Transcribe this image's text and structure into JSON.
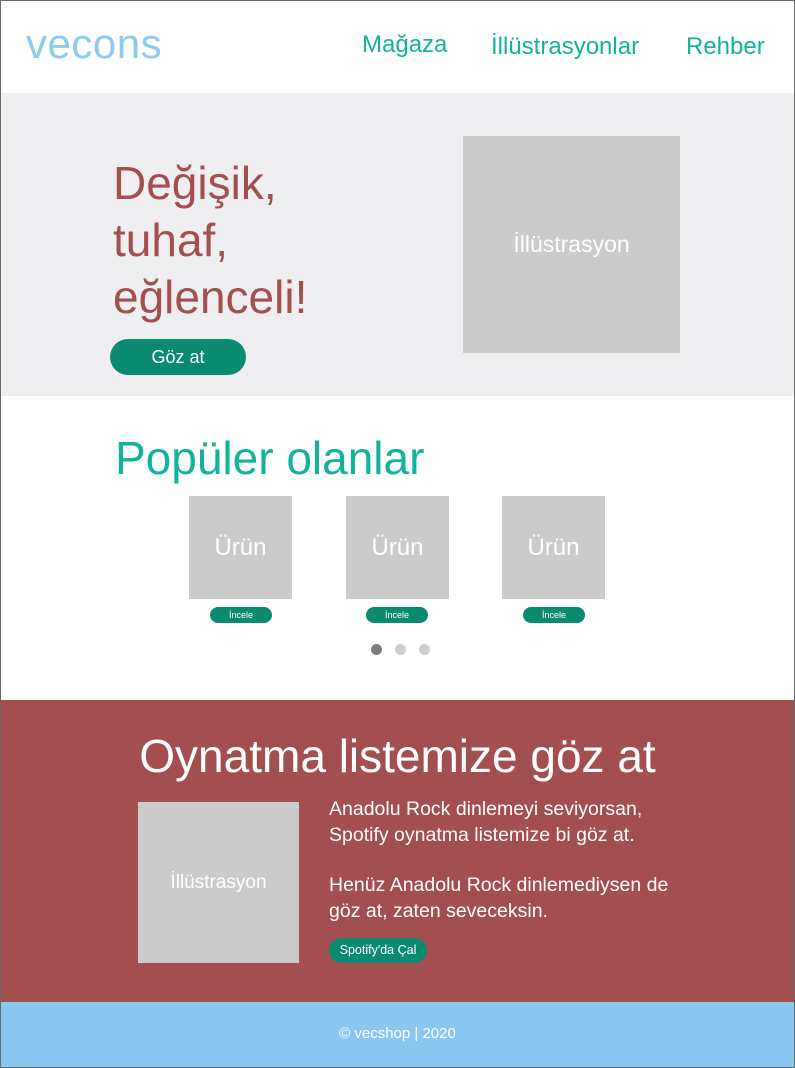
{
  "header": {
    "logo": "vecons",
    "nav": [
      "Mağaza",
      "İllüstrasyonlar",
      "Rehber"
    ]
  },
  "hero": {
    "title_lines": [
      "Değişik,",
      "tuhaf,",
      "eğlenceli!"
    ],
    "button_label": "Göz at",
    "image_placeholder": "İllüstrasyon"
  },
  "popular": {
    "title": "Popüler olanlar",
    "products": [
      {
        "label": "Ürün",
        "button": "İncele"
      },
      {
        "label": "Ürün",
        "button": "İncele"
      },
      {
        "label": "Ürün",
        "button": "İncele"
      }
    ],
    "carousel": {
      "pages": 3,
      "active_index": 0
    }
  },
  "playlist": {
    "title": "Oynatma listemize göz at",
    "image_placeholder": "İllüstrasyon",
    "paragraph1": "Anadolu Rock dinlemeyi seviyorsan, Spotify oynatma listemize bi göz at.",
    "paragraph2": "Henüz Anadolu Rock dinlemediysen de göz at, zaten seveceksin.",
    "button_label": "Spotify'da Çal"
  },
  "footer": {
    "text": "© vecshop | 2020"
  },
  "colors": {
    "logo": "#8ecaee",
    "nav": "#12b39a",
    "hero_bg": "#efeff1",
    "hero_title": "#a34f4f",
    "button": "#0b8a72",
    "placeholder": "#cbcbcb",
    "playlist_bg": "#a34f4f",
    "footer_bg": "#8ac7f0"
  }
}
